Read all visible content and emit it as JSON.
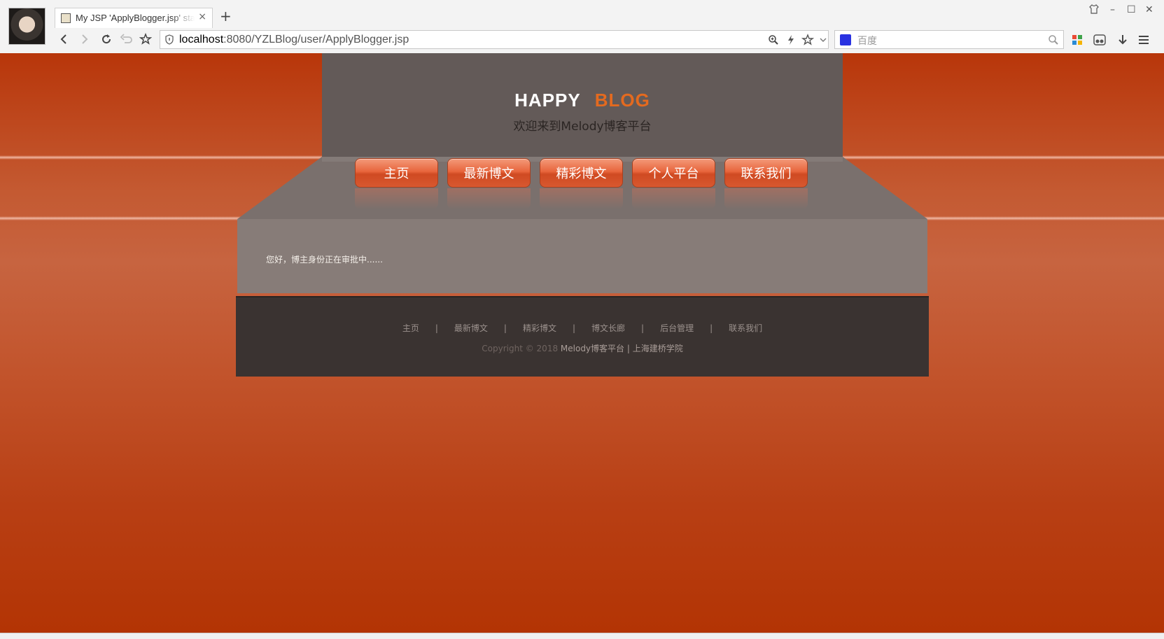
{
  "browser": {
    "tab_title": "My JSP 'ApplyBlogger.jsp' starting page",
    "address_host": "localhost",
    "address_rest": ":8080/YZLBlog/user/ApplyBlogger.jsp",
    "search_placeholder": "百度",
    "new_tab_label": "+",
    "close_tab_label": "×",
    "window_minimize": "–",
    "window_maximize": "☐",
    "window_close": "✕"
  },
  "site": {
    "logo_word1": "HAPPY",
    "logo_word2": "BLOG",
    "subtitle": "欢迎来到Melody博客平台",
    "nav": [
      {
        "label": "主页"
      },
      {
        "label": "最新博文"
      },
      {
        "label": "精彩博文"
      },
      {
        "label": "个人平台"
      },
      {
        "label": "联系我们"
      }
    ],
    "message": "您好，博主身份正在审批中......",
    "footer_links": [
      {
        "label": "主页"
      },
      {
        "label": "最新博文"
      },
      {
        "label": "精彩博文"
      },
      {
        "label": "博文长廊"
      },
      {
        "label": "后台管理"
      },
      {
        "label": "联系我们"
      }
    ],
    "copyright_prefix": "Copyright © 2018 ",
    "copyright_site": "Melody博客平台 | 上海建桥学院"
  },
  "colors": {
    "page_accent": "#b8360a",
    "nav_button": "#e8653c",
    "logo_blog": "#e46a1f",
    "header_panel": "#635a58",
    "footer_bg": "#3a3331"
  }
}
